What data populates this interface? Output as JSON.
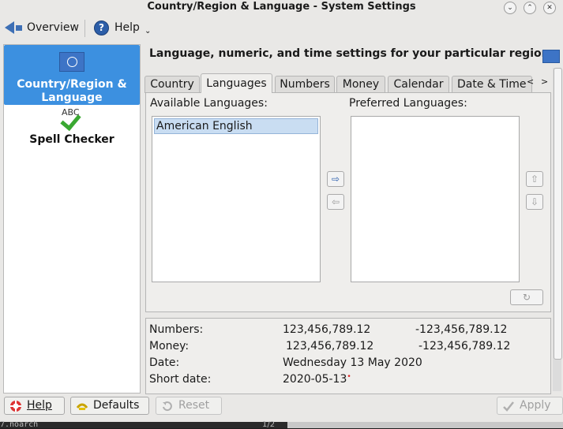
{
  "window": {
    "title": "Country/Region & Language - System Settings",
    "controls": {
      "minimize": "⌄",
      "restore": "⌃",
      "close": "✕"
    }
  },
  "toolbar": {
    "overview_label": "Overview",
    "help_label": "Help",
    "help_icon_glyph": "?",
    "menu_caret": "⌄"
  },
  "sidebar": {
    "items": [
      {
        "label": "Country/Region & Language",
        "icon": "un-flag-icon",
        "selected": true
      },
      {
        "label": "Spell Checker",
        "icon": "spell-check-icon",
        "icon_text": "ABC",
        "selected": false
      }
    ]
  },
  "header": {
    "text": "Language, numeric, and time settings for your particular region"
  },
  "tabs": [
    {
      "label": "Country"
    },
    {
      "label": "Languages",
      "active": true
    },
    {
      "label": "Numbers"
    },
    {
      "label": "Money"
    },
    {
      "label": "Calendar"
    },
    {
      "label": "Date & Time"
    }
  ],
  "tab_scroll": {
    "left": "<",
    "right": ">"
  },
  "languages": {
    "available_label": "Available Languages:",
    "preferred_label": "Preferred Languages:",
    "available": [
      "American English"
    ],
    "preferred": [],
    "move_right_glyph": "⇨",
    "move_left_glyph": "⇦",
    "move_up_glyph": "⇧",
    "move_down_glyph": "⇩",
    "apply_glyph": "↻"
  },
  "examples": {
    "rows": [
      {
        "label": "Numbers:",
        "positive": "123,456,789.12",
        "negative": "-123,456,789.12"
      },
      {
        "label": "Money:",
        "positive": "123,456,789.12",
        "negative": "-123,456,789.12"
      },
      {
        "label": "Date:",
        "value": "Wednesday 13 May 2020"
      },
      {
        "label": "Short date:",
        "value": "2020-05-13",
        "marker": "•"
      }
    ]
  },
  "buttons": {
    "help": "Help",
    "defaults": "Defaults",
    "reset": "Reset",
    "apply": "Apply"
  },
  "taskbar": {
    "left_text": "7.noarch",
    "page_indicator": "1/2"
  },
  "colors": {
    "selection": "#3c90e0",
    "window_bg": "#e9e8e6",
    "list_selection": "#c9ddf2"
  }
}
